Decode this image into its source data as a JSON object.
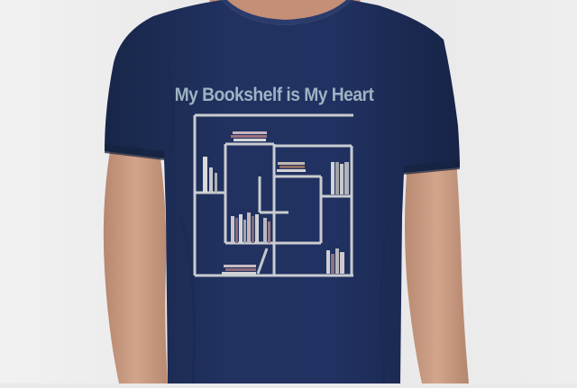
{
  "photo": {
    "colors": {
      "background": "#e9e9ea",
      "shirt": "#1f2f5b",
      "shirt_shadow": "#16223f",
      "skin": "#c99b83",
      "skin_shadow": "#b2836c",
      "shelf": "#c9ccd0",
      "title": "#9db3c4"
    }
  },
  "print": {
    "title": "My Bookshelf is My Heart"
  }
}
